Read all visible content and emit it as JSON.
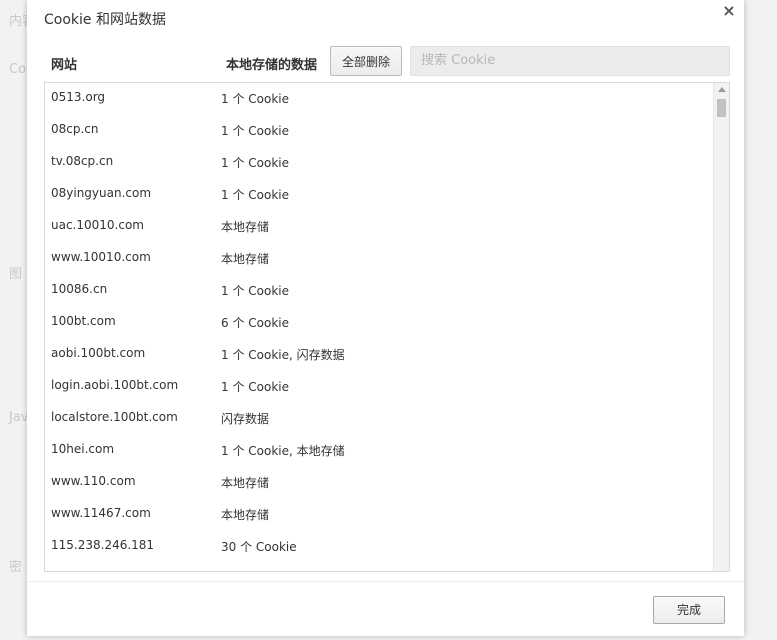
{
  "background": {
    "snippets": [
      "内容",
      "Co",
      "图",
      "Jav",
      "密"
    ]
  },
  "dialog": {
    "title": "Cookie 和网站数据",
    "close_symbol": "×"
  },
  "header": {
    "site_col": "网站",
    "data_col": "本地存储的数据",
    "remove_all_label": "全部删除",
    "search_placeholder": "搜索 Cookie"
  },
  "rows": [
    {
      "site": "0513.org",
      "data": "1 个 Cookie"
    },
    {
      "site": "08cp.cn",
      "data": "1 个 Cookie"
    },
    {
      "site": "tv.08cp.cn",
      "data": "1 个 Cookie"
    },
    {
      "site": "08yingyuan.com",
      "data": "1 个 Cookie"
    },
    {
      "site": "uac.10010.com",
      "data": "本地存储"
    },
    {
      "site": "www.10010.com",
      "data": "本地存储"
    },
    {
      "site": "10086.cn",
      "data": "1 个 Cookie"
    },
    {
      "site": "100bt.com",
      "data": "6 个 Cookie"
    },
    {
      "site": "aobi.100bt.com",
      "data": "1 个 Cookie, 闪存数据"
    },
    {
      "site": "login.aobi.100bt.com",
      "data": "1 个 Cookie"
    },
    {
      "site": "localstore.100bt.com",
      "data": "闪存数据"
    },
    {
      "site": "10hei.com",
      "data": "1 个 Cookie, 本地存储"
    },
    {
      "site": "www.110.com",
      "data": "本地存储"
    },
    {
      "site": "www.11467.com",
      "data": "本地存储"
    },
    {
      "site": "115.238.246.181",
      "data": "30 个 Cookie"
    }
  ],
  "footer": {
    "done_label": "完成"
  }
}
